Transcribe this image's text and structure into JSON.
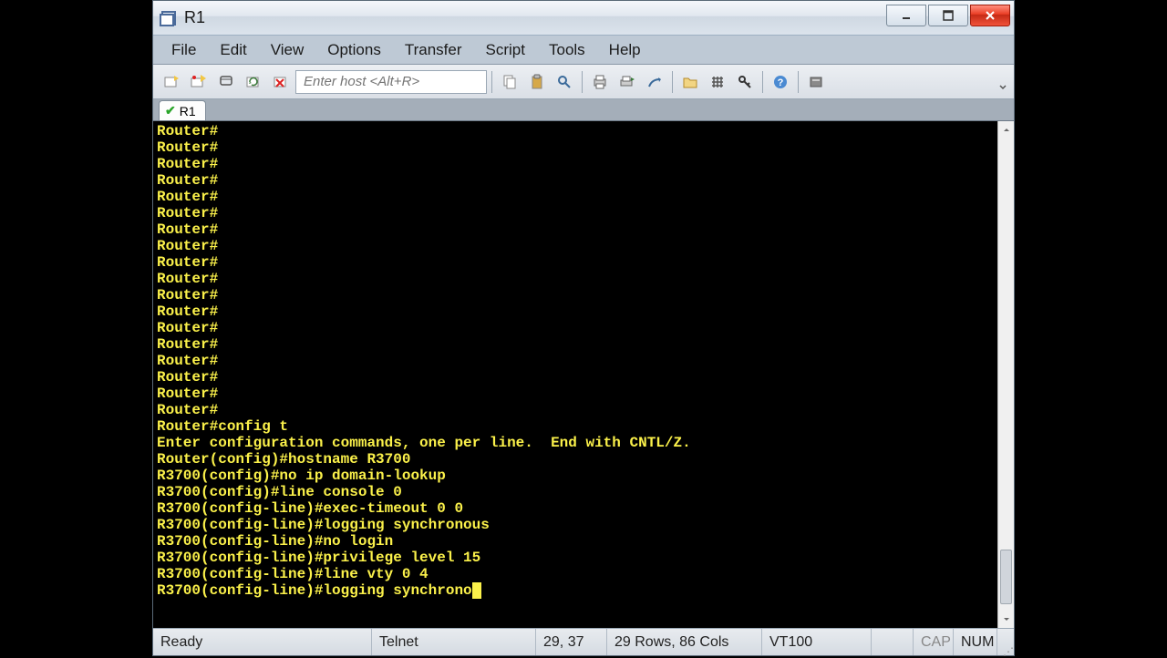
{
  "window": {
    "title": "R1"
  },
  "menubar": [
    "File",
    "Edit",
    "View",
    "Options",
    "Transfer",
    "Script",
    "Tools",
    "Help"
  ],
  "toolbar": {
    "host_placeholder": "Enter host <Alt+R>"
  },
  "tab": {
    "label": "R1"
  },
  "terminal": {
    "lines": [
      "Router#",
      "Router#",
      "Router#",
      "Router#",
      "Router#",
      "Router#",
      "Router#",
      "Router#",
      "Router#",
      "Router#",
      "Router#",
      "Router#",
      "Router#",
      "Router#",
      "Router#",
      "Router#",
      "Router#",
      "Router#",
      "Router#config t",
      "Enter configuration commands, one per line.  End with CNTL/Z.",
      "Router(config)#hostname R3700",
      "R3700(config)#no ip domain-lookup",
      "R3700(config)#line console 0",
      "R3700(config-line)#exec-timeout 0 0",
      "R3700(config-line)#logging synchronous",
      "R3700(config-line)#no login",
      "R3700(config-line)#privilege level 15",
      "R3700(config-line)#line vty 0 4",
      "R3700(config-line)#logging synchrono"
    ]
  },
  "statusbar": {
    "ready": "Ready",
    "connection": "Telnet",
    "position": "29, 37",
    "dimensions": "29 Rows, 86 Cols",
    "emulation": "VT100",
    "cap": "CAP",
    "num": "NUM"
  }
}
